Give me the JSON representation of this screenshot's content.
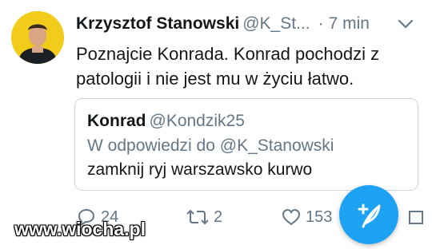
{
  "tweet": {
    "author_name": "Krzysztof Stanowski",
    "author_handle": "@K_St...",
    "separator": "·",
    "time": "7 min",
    "text": "Poznajcie Konrada. Konrad pochodzi z patologii i nie jest mu w życiu łatwo.",
    "avatar_icon": "profile-photo"
  },
  "quoted": {
    "name": "Konrad",
    "handle": "@Kondzik25",
    "reply_to": "W odpowiedzi do @K_Stanowski",
    "text": "zamknij ryj warszawsko kurwo"
  },
  "actions": {
    "reply_count": "24",
    "retweet_count": "2",
    "like_count": "153"
  },
  "compose_fab": {
    "icon": "compose-feather-icon"
  },
  "watermark": "www.wiocha.pl",
  "colors": {
    "accent": "#1da1f2",
    "muted": "#657786",
    "border": "#ccd6dd",
    "text": "#14171a"
  }
}
